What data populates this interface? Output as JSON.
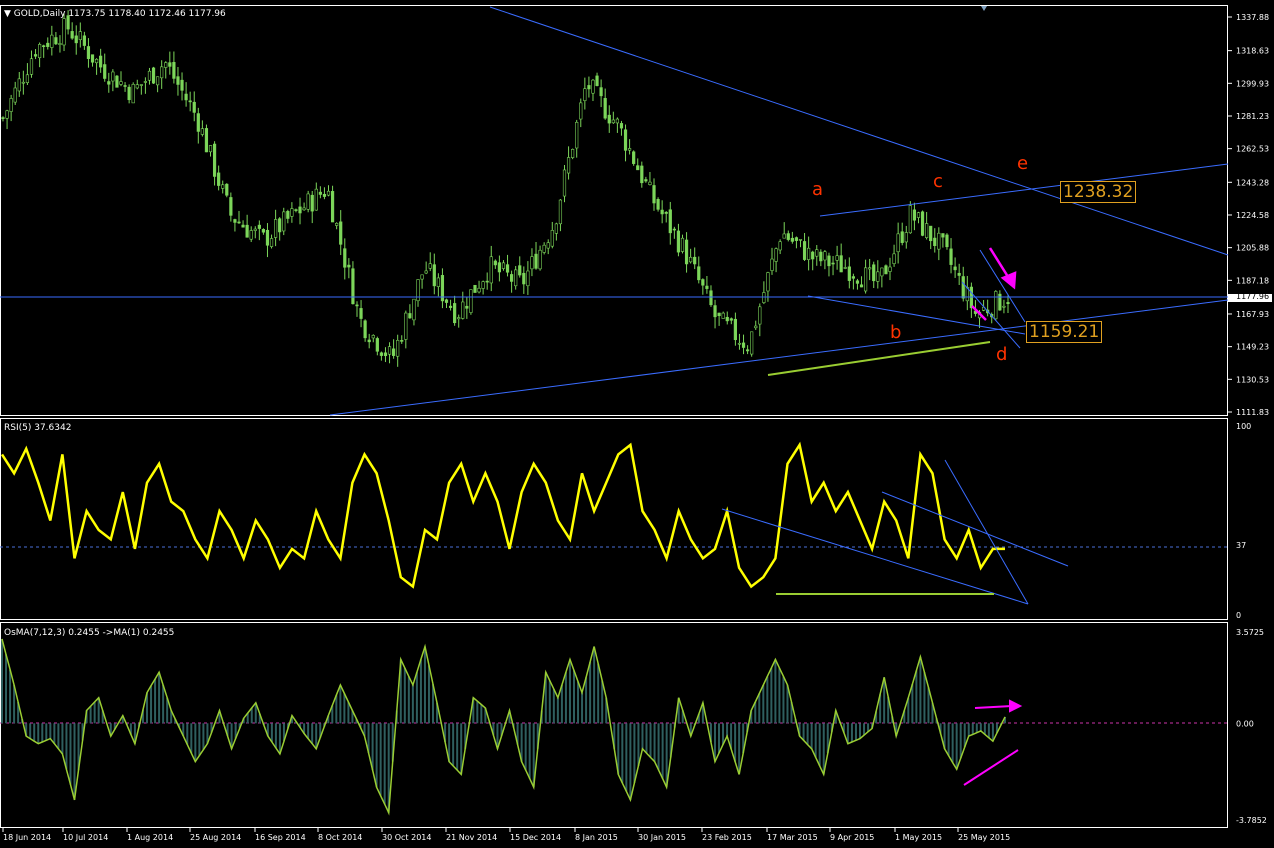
{
  "header": {
    "symbol": "GOLD,Daily",
    "ohlc": "1173.75 1178.40 1172.46 1177.96",
    "current_price_label": "1177.96",
    "price_boxes": [
      "1238.32",
      "1159.21"
    ],
    "wave_labels": [
      "a",
      "b",
      "c",
      "d",
      "e"
    ]
  },
  "colors": {
    "background": "#000000",
    "candles": "#7cd65a",
    "trendlines": "#3a6cff",
    "rsi_line": "#ffff00",
    "osma_fill": "#2f5f5f",
    "osma_line": "#9acd32",
    "support_mark": "#9acd32",
    "arrows": "#ff00ff",
    "wave_labels": "#ff3300",
    "price_boxes": "#e0a020"
  },
  "chart_data": [
    {
      "type": "candlestick",
      "title": "GOLD,Daily",
      "ylim": [
        1111.83,
        1337.88
      ],
      "y_ticks": [
        "1337.88",
        "1318.63",
        "1299.93",
        "1281.23",
        "1262.53",
        "1243.28",
        "1224.58",
        "1205.88",
        "1187.18",
        "1167.93",
        "1149.23",
        "1130.53",
        "1111.83"
      ],
      "x_ticks": [
        "18 Jun 2014",
        "10 Jul 2014",
        "1 Aug 2014",
        "25 Aug 2014",
        "16 Sep 2014",
        "8 Oct 2014",
        "30 Oct 2014",
        "21 Nov 2014",
        "15 Dec 2014",
        "8 Jan 2015",
        "30 Jan 2015",
        "23 Feb 2015",
        "17 Mar 2015",
        "9 Apr 2015",
        "1 May 2015",
        "25 May 2015"
      ],
      "approx_close_path": [
        {
          "date": "18 Jun 2014",
          "close": 1280
        },
        {
          "date": "1 Jul 2014",
          "close": 1320
        },
        {
          "date": "10 Jul 2014",
          "close": 1332
        },
        {
          "date": "21 Jul 2014",
          "close": 1310
        },
        {
          "date": "1 Aug 2014",
          "close": 1295
        },
        {
          "date": "12 Aug 2014",
          "close": 1312
        },
        {
          "date": "25 Aug 2014",
          "close": 1280
        },
        {
          "date": "16 Sep 2014",
          "close": 1225
        },
        {
          "date": "1 Oct 2014",
          "close": 1210
        },
        {
          "date": "8 Oct 2014",
          "close": 1225
        },
        {
          "date": "20 Oct 2014",
          "close": 1240
        },
        {
          "date": "30 Oct 2014",
          "close": 1165
        },
        {
          "date": "6 Nov 2014",
          "close": 1142
        },
        {
          "date": "21 Nov 2014",
          "close": 1195
        },
        {
          "date": "1 Dec 2014",
          "close": 1168
        },
        {
          "date": "15 Dec 2014",
          "close": 1195
        },
        {
          "date": "30 Dec 2014",
          "close": 1185
        },
        {
          "date": "8 Jan 2015",
          "close": 1220
        },
        {
          "date": "20 Jan 2015",
          "close": 1300
        },
        {
          "date": "30 Jan 2015",
          "close": 1275
        },
        {
          "date": "10 Feb 2015",
          "close": 1235
        },
        {
          "date": "23 Feb 2015",
          "close": 1205
        },
        {
          "date": "6 Mar 2015",
          "close": 1165
        },
        {
          "date": "17 Mar 2015",
          "close": 1150
        },
        {
          "date": "26 Mar 2015",
          "close": 1215
        },
        {
          "date": "9 Apr 2015",
          "close": 1200
        },
        {
          "date": "20 Apr 2015",
          "close": 1195
        },
        {
          "date": "1 May 2015",
          "close": 1185
        },
        {
          "date": "12 May 2015",
          "close": 1225
        },
        {
          "date": "25 May 2015",
          "close": 1205
        },
        {
          "date": "5 Jun 2015",
          "close": 1168
        },
        {
          "date": "12 Jun 2015",
          "close": 1178
        }
      ]
    },
    {
      "type": "line",
      "title": "RSI(5) 37.6342",
      "ylim": [
        0,
        100
      ],
      "y_ticks": [
        "100",
        "37",
        "0"
      ],
      "level": 37,
      "series": [
        {
          "values": [
            85,
            75,
            88,
            70,
            50,
            85,
            30,
            55,
            45,
            40,
            65,
            35,
            70,
            80,
            60,
            55,
            40,
            30,
            55,
            45,
            30,
            50,
            40,
            25,
            35,
            30,
            55,
            40,
            30,
            70,
            85,
            75,
            50,
            20,
            15,
            45,
            40,
            70,
            80,
            60,
            75,
            60,
            35,
            65,
            80,
            70,
            50,
            40,
            75,
            55,
            70,
            85,
            90,
            55,
            45,
            30,
            55,
            40,
            30,
            35,
            55,
            25,
            15,
            20,
            30,
            80,
            90,
            60,
            70,
            55,
            65,
            50,
            35,
            60,
            50,
            30,
            85,
            75,
            40,
            30,
            45,
            25,
            35,
            35
          ]
        }
      ]
    },
    {
      "type": "histogram",
      "title": "OsMA(7,12,3) 0.2455 ->MA(1) 0.2455",
      "ylim": [
        -3.7852,
        3.5725
      ],
      "y_ticks": [
        "3.5725",
        "0.00",
        "-3.7852"
      ],
      "series": [
        {
          "values": [
            3.3,
            1.5,
            -0.5,
            -0.8,
            -0.6,
            -1.2,
            -3.0,
            0.5,
            1.0,
            -0.5,
            0.3,
            -0.8,
            1.2,
            2.0,
            0.5,
            -0.5,
            -1.5,
            -0.8,
            0.5,
            -1.0,
            0.2,
            0.8,
            -0.5,
            -1.2,
            0.3,
            -0.4,
            -1.0,
            0.3,
            1.5,
            0.5,
            -0.5,
            -2.5,
            -3.5,
            2.5,
            1.5,
            3.0,
            0.8,
            -1.5,
            -2.0,
            1.0,
            0.6,
            -1.0,
            0.5,
            -1.5,
            -2.5,
            2.0,
            1.0,
            2.5,
            1.2,
            3.0,
            1.0,
            -2.0,
            -3.0,
            -1.0,
            -1.5,
            -2.5,
            1.0,
            -0.5,
            0.8,
            -1.5,
            -0.5,
            -2.0,
            0.5,
            1.5,
            2.5,
            1.5,
            -0.5,
            -1.0,
            -2.0,
            0.5,
            -0.8,
            -0.6,
            -0.2,
            1.8,
            -0.5,
            1.0,
            2.6,
            0.8,
            -1.0,
            -1.8,
            -0.5,
            -0.3,
            -0.7,
            0.25
          ]
        }
      ]
    }
  ]
}
